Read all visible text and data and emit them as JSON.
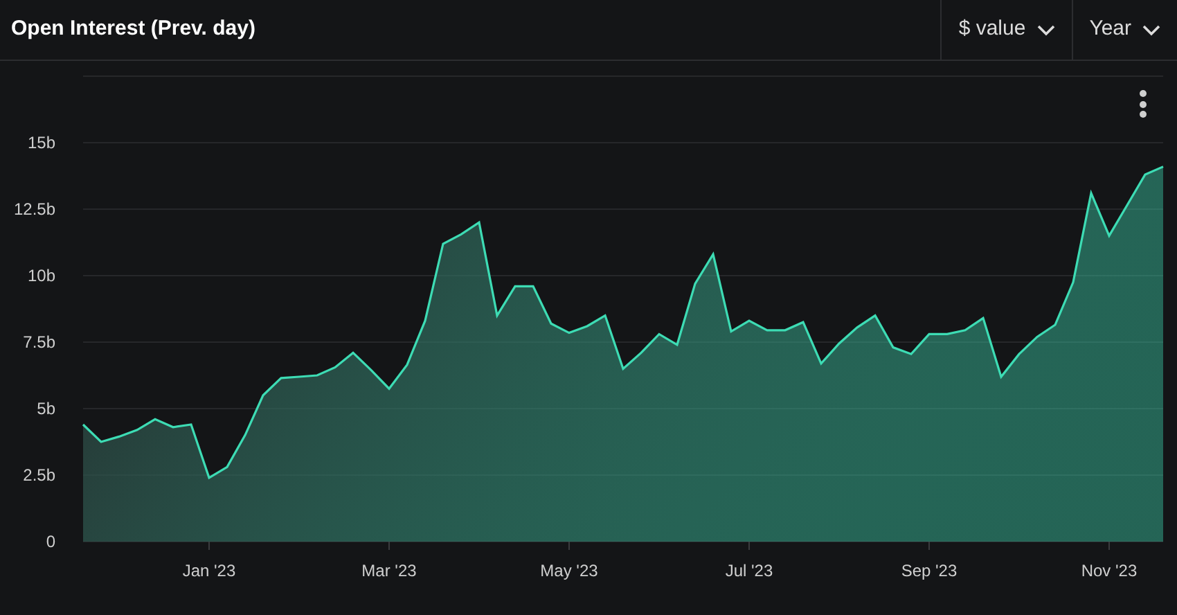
{
  "header": {
    "title": "Open Interest (Prev. day)",
    "dropdowns": [
      {
        "label": "$ value"
      },
      {
        "label": "Year"
      }
    ]
  },
  "chart": {
    "chart_data": {
      "type": "area",
      "grid": true,
      "ylim": [
        0,
        17.5
      ],
      "categories": [
        null,
        null,
        null,
        null,
        null,
        null,
        null,
        "Jan '23",
        null,
        null,
        null,
        null,
        null,
        null,
        null,
        null,
        null,
        "Mar '23",
        null,
        null,
        null,
        null,
        null,
        null,
        null,
        null,
        null,
        "May '23",
        null,
        null,
        null,
        null,
        null,
        null,
        null,
        null,
        null,
        "Jul '23",
        null,
        null,
        null,
        null,
        null,
        null,
        null,
        null,
        null,
        "Sep '23",
        null,
        null,
        null,
        null,
        null,
        null,
        null,
        null,
        null,
        "Nov '23",
        null,
        null,
        null
      ],
      "series": [
        {
          "color": "#3ddcb4",
          "values": [
            4.4,
            3.75,
            3.95,
            4.2,
            4.6,
            4.3,
            4.4,
            2.4,
            2.8,
            4.0,
            5.5,
            6.15,
            6.2,
            6.25,
            6.55,
            7.1,
            6.45,
            5.75,
            6.65,
            8.3,
            11.2,
            11.55,
            12.0,
            8.5,
            9.6,
            9.6,
            8.2,
            7.85,
            8.1,
            8.5,
            6.5,
            7.1,
            7.8,
            7.4,
            9.7,
            10.8,
            7.9,
            8.3,
            7.95,
            7.95,
            8.25,
            6.7,
            7.45,
            8.05,
            8.5,
            7.3,
            7.05,
            7.8,
            7.8,
            7.95,
            8.4,
            6.2,
            7.05,
            7.7,
            8.15,
            9.75,
            13.1,
            11.5,
            12.65,
            13.8,
            14.1
          ]
        }
      ],
      "yticks": [
        {
          "value": 0,
          "label": "0"
        },
        {
          "value": 2.5,
          "label": "2.5b"
        },
        {
          "value": 5,
          "label": "5b"
        },
        {
          "value": 7.5,
          "label": "7.5b"
        },
        {
          "value": 10,
          "label": "10b"
        },
        {
          "value": 12.5,
          "label": "12.5b"
        },
        {
          "value": 15,
          "label": "15b"
        }
      ]
    }
  }
}
